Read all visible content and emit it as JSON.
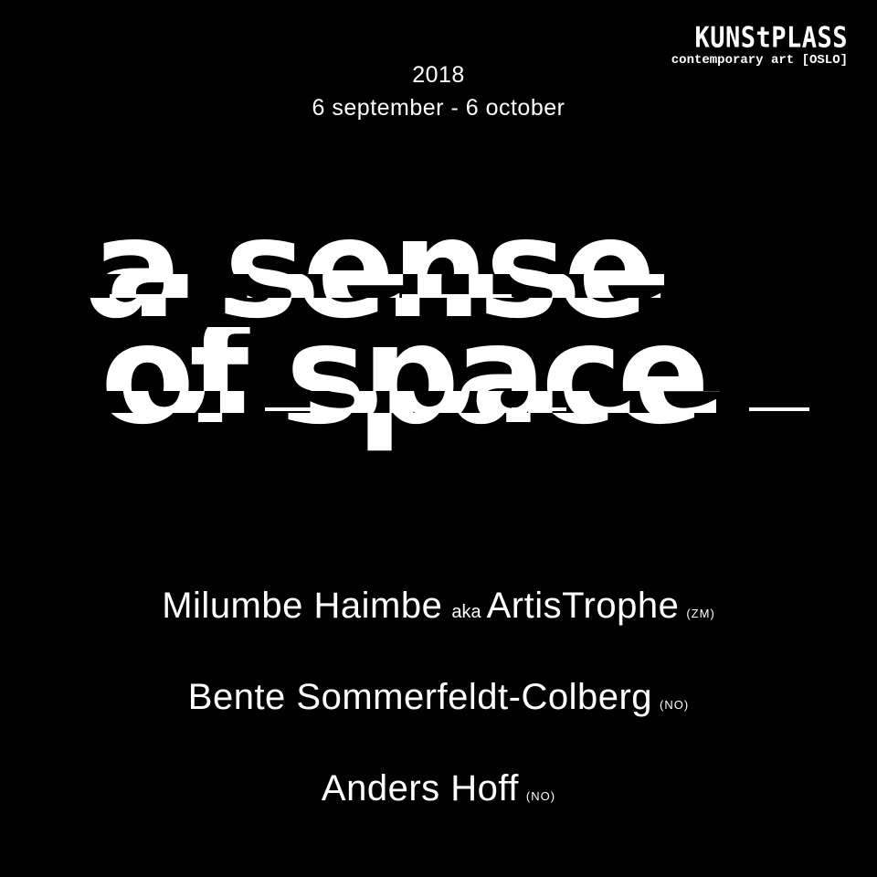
{
  "logo": {
    "name": "KUNStPLASS",
    "subtitle": "contemporary art [OSLO]"
  },
  "event": {
    "year": "2018",
    "dates": "6 september - 6 october"
  },
  "title": {
    "line1": "a sense",
    "line2": "of space"
  },
  "artists": [
    {
      "name": "Milumbe Haimbe",
      "aka": "aka",
      "alias": "ArtisTrophe",
      "country": "(ZM)"
    },
    {
      "name": "Bente Sommerfeldt-Colberg",
      "country": "(NO)"
    },
    {
      "name": "Anders Hoff",
      "country": "(NO)"
    }
  ],
  "colors": {
    "background": "#000000",
    "foreground": "#ffffff"
  }
}
